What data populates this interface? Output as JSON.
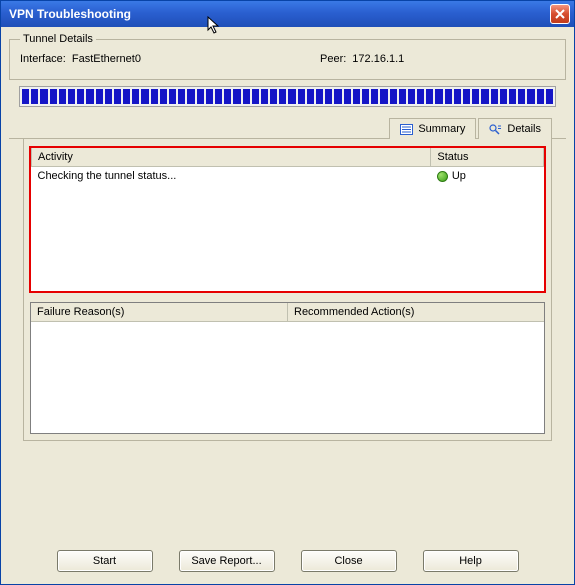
{
  "window": {
    "title": "VPN Troubleshooting"
  },
  "tunnel": {
    "legend": "Tunnel Details",
    "interface_label": "Interface:",
    "interface_value": "FastEthernet0",
    "peer_label": "Peer:",
    "peer_value": "172.16.1.1"
  },
  "tabs": {
    "summary": "Summary",
    "details": "Details"
  },
  "activity_table": {
    "col_activity": "Activity",
    "col_status": "Status",
    "rows": [
      {
        "activity": "Checking the tunnel status...",
        "status": "Up"
      }
    ]
  },
  "lower": {
    "failure": "Failure Reason(s)",
    "action": "Recommended Action(s)"
  },
  "buttons": {
    "start": "Start",
    "save": "Save Report...",
    "close": "Close",
    "help": "Help"
  }
}
